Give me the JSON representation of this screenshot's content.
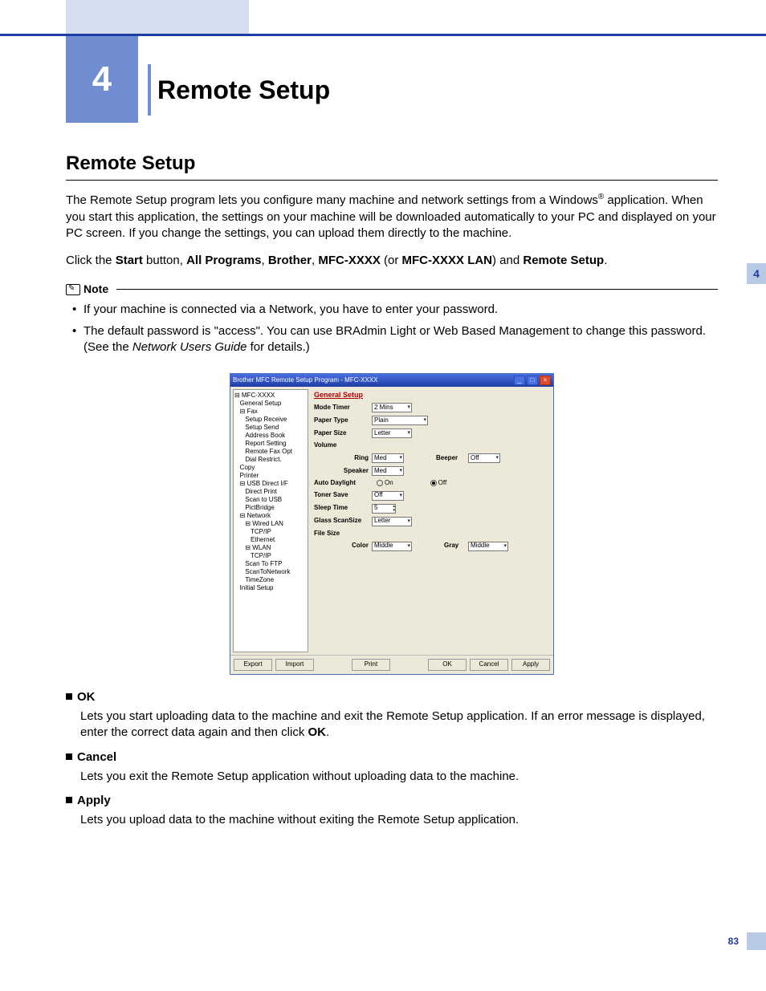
{
  "chapter": {
    "num": "4",
    "title": "Remote Setup"
  },
  "side_tab": "4",
  "section_title": "Remote Setup",
  "intro1_a": "The Remote Setup program lets you configure many machine and network settings from a Windows",
  "intro1_b": " application. When you start this application, the settings on your machine will be downloaded automatically to your PC and displayed on your PC screen. If you change the settings, you can upload them directly to the machine.",
  "intro2": {
    "pre": "Click the ",
    "b1": "Start",
    "t1": " button, ",
    "b2": "All Programs",
    "t2": ", ",
    "b3": "Brother",
    "t3": ", ",
    "b4": "MFC-XXXX",
    "t4": " (or ",
    "b5": "MFC-XXXX LAN",
    "t5": ") and ",
    "b6": "Remote Setup",
    "t6": "."
  },
  "note": {
    "label": "Note",
    "items": [
      "If your machine is connected via a Network, you have to enter your password.",
      "The default password is \"access\". You can use BRAdmin Light or Web Based Management to change this password. (See the Network Users Guide for details.)"
    ],
    "italic_phrase": "Network Users Guide"
  },
  "screenshot": {
    "title": "Brother MFC Remote Setup Program - MFC-XXXX",
    "tree": [
      "⊟ MFC-XXXX",
      "   General Setup",
      "   ⊟ Fax",
      "      Setup Receive",
      "      Setup Send",
      "      Address Book",
      "      Report Setting",
      "      Remote Fax Opt",
      "      Dial Restrict.",
      "   Copy",
      "   Printer",
      "   ⊟ USB Direct I/F",
      "      Direct Print",
      "      Scan to USB",
      "      PictBridge",
      "   ⊟ Network",
      "      ⊟ Wired LAN",
      "         TCP/IP",
      "         Ethernet",
      "      ⊟ WLAN",
      "         TCP/IP",
      "      Scan To FTP",
      "      ScanToNetwork",
      "      TimeZone",
      "   Initial Setup"
    ],
    "tree_selected_index": 1,
    "panel_title": "General Setup",
    "fields": {
      "mode_timer": {
        "label": "Mode Timer",
        "value": "2 Mins"
      },
      "paper_type": {
        "label": "Paper Type",
        "value": "Plain"
      },
      "paper_size": {
        "label": "Paper Size",
        "value": "Letter"
      },
      "volume": {
        "label": "Volume"
      },
      "ring": {
        "label": "Ring",
        "value": "Med"
      },
      "beeper": {
        "label": "Beeper",
        "value": "Off"
      },
      "speaker": {
        "label": "Speaker",
        "value": "Med"
      },
      "auto_daylight": {
        "label": "Auto Daylight",
        "on": "On",
        "off": "Off",
        "selected": "Off"
      },
      "toner_save": {
        "label": "Toner Save",
        "value": "Off"
      },
      "sleep_time": {
        "label": "Sleep Time",
        "value": "5"
      },
      "glass_scan": {
        "label": "Glass ScanSize",
        "value": "Letter"
      },
      "file_size": {
        "label": "File Size"
      },
      "color": {
        "label": "Color",
        "value": "Middle"
      },
      "gray": {
        "label": "Gray",
        "value": "Middle"
      }
    },
    "buttons": {
      "export": "Export",
      "import": "Import",
      "print": "Print",
      "ok": "OK",
      "cancel": "Cancel",
      "apply": "Apply"
    }
  },
  "desc": {
    "ok": {
      "head": "OK",
      "body_a": "Lets you start uploading data to the machine and exit the Remote Setup application. If an error message is displayed, enter the correct data again and then click ",
      "body_b": "OK",
      "body_c": "."
    },
    "cancel": {
      "head": "Cancel",
      "body": "Lets you exit the Remote Setup application without uploading data to the machine."
    },
    "apply": {
      "head": "Apply",
      "body": "Lets you upload data to the machine without exiting the Remote Setup application."
    }
  },
  "page_number": "83"
}
